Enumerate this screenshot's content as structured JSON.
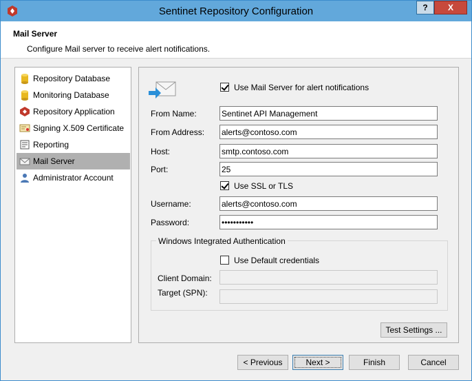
{
  "window": {
    "title": "Sentinet Repository Configuration",
    "help_label": "?",
    "close_label": "X"
  },
  "header": {
    "title": "Mail Server",
    "description": "Configure Mail server to receive alert notifications."
  },
  "sidebar": {
    "items": [
      {
        "label": "Repository Database",
        "icon": "database-icon"
      },
      {
        "label": "Monitoring Database",
        "icon": "database-icon"
      },
      {
        "label": "Repository Application",
        "icon": "app-icon"
      },
      {
        "label": "Signing X.509 Certificate",
        "icon": "certificate-icon"
      },
      {
        "label": "Reporting",
        "icon": "report-icon"
      },
      {
        "label": "Mail Server",
        "icon": "mail-icon",
        "selected": true
      },
      {
        "label": "Administrator Account",
        "icon": "user-icon"
      }
    ]
  },
  "form": {
    "use_mail_label": "Use Mail Server for alert notifications",
    "use_mail_checked": true,
    "from_name_label": "From Name:",
    "from_name_value": "Sentinet API Management",
    "from_address_label": "From Address:",
    "from_address_value": "alerts@contoso.com",
    "host_label": "Host:",
    "host_value": "smtp.contoso.com",
    "port_label": "Port:",
    "port_value": "25",
    "ssl_label": "Use SSL or TLS",
    "ssl_checked": true,
    "username_label": "Username:",
    "username_value": "alerts@contoso.com",
    "password_label": "Password:",
    "password_value": "•••••••••••",
    "wia_group_label": "Windows Integrated Authentication",
    "default_creds_label": "Use Default credentials",
    "default_creds_checked": false,
    "client_domain_label": "Client Domain:",
    "client_domain_value": "",
    "target_label": "Target (SPN):",
    "target_value": "",
    "test_settings_label": "Test Settings ..."
  },
  "footer": {
    "previous_label": "< Previous",
    "next_label": "Next >",
    "finish_label": "Finish",
    "cancel_label": "Cancel"
  },
  "colors": {
    "titlebar": "#62a8db",
    "close": "#c7493c",
    "selected_item": "#b0b0b0"
  }
}
